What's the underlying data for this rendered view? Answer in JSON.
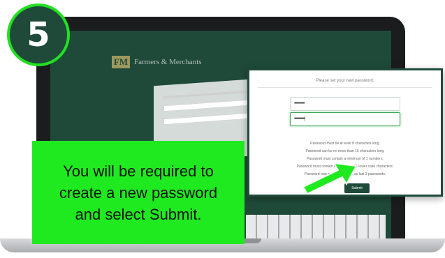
{
  "step": {
    "number": "5"
  },
  "background_app": {
    "logo_mark": "FM",
    "logo_text": "Farmers & Merchants"
  },
  "reset_dialog": {
    "title": "Please set your new password.",
    "password_value": "••••••••••",
    "confirm_value": "••••••••••|",
    "rules": [
      "Password must be at least 8 characters long.",
      "Password can be no more than 16 characters long.",
      "Password must contain a minimum of 1 numbers.",
      "Password must contain a minimum of 1 lower case characters.",
      "Password may not be the same as last 3 passwords."
    ],
    "submit_label": "Submit"
  },
  "callout": {
    "text": "You will be required to\ncreate a new password\nand select Submit."
  },
  "colors": {
    "brand_green": "#1f4a3a",
    "highlight_green": "#1fea1f",
    "badge_ring": "#22e022"
  }
}
